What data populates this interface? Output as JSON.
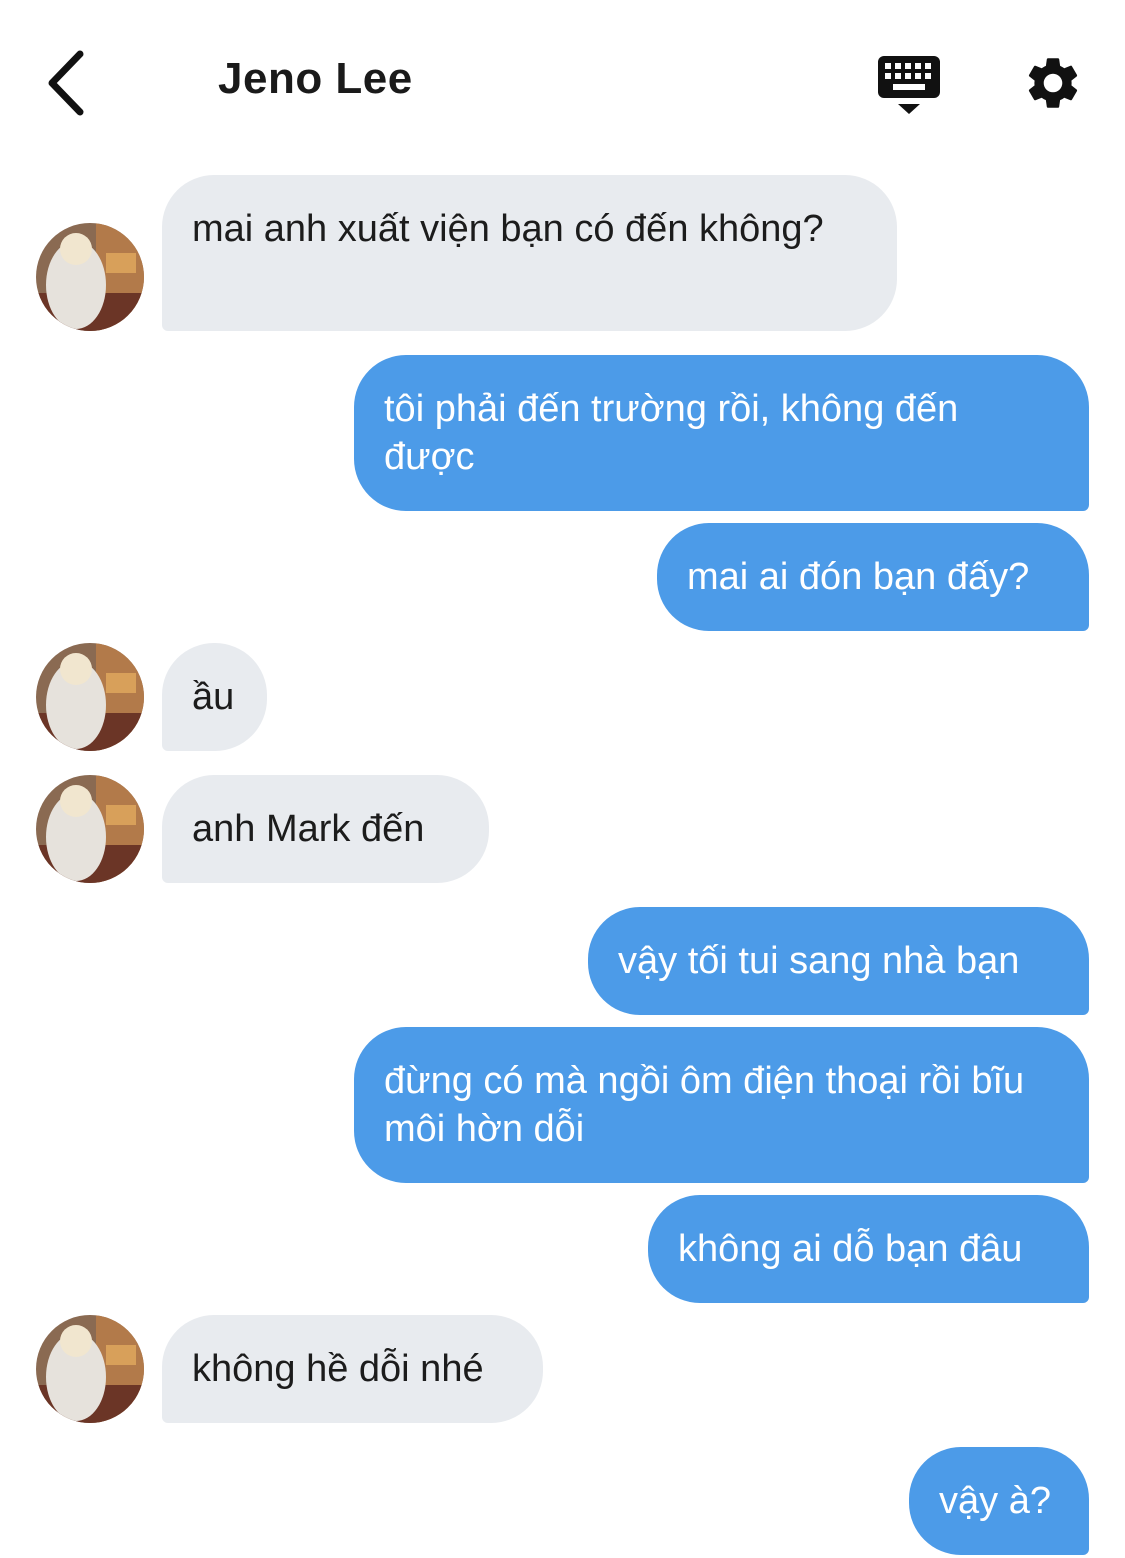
{
  "header": {
    "title": "Jeno Lee",
    "back_icon": "chevron-left-icon",
    "keyboard_icon": "keyboard-icon",
    "settings_icon": "gear-icon"
  },
  "colors": {
    "incoming_bubble": "#e8ebef",
    "outgoing_bubble": "#4c9be8",
    "incoming_text": "#1c1c1c",
    "outgoing_text": "#ffffff"
  },
  "messages": [
    {
      "direction": "in",
      "text": "mai anh xuất viện bạn có đến không?"
    },
    {
      "direction": "out",
      "text": "tôi phải đến trường rồi, không đến được"
    },
    {
      "direction": "out",
      "text": "mai ai đón bạn đấy?"
    },
    {
      "direction": "in",
      "text": "ầu"
    },
    {
      "direction": "in",
      "text": "anh Mark đến"
    },
    {
      "direction": "out",
      "text": "vậy tối tui sang nhà bạn"
    },
    {
      "direction": "out",
      "text": "đừng có mà ngồi ôm điện thoại rồi bĩu môi hờn dỗi"
    },
    {
      "direction": "out",
      "text": "không ai dỗ bạn đâu"
    },
    {
      "direction": "in",
      "text": "không hề dỗi nhé"
    },
    {
      "direction": "out",
      "text": "vậy à?"
    }
  ]
}
